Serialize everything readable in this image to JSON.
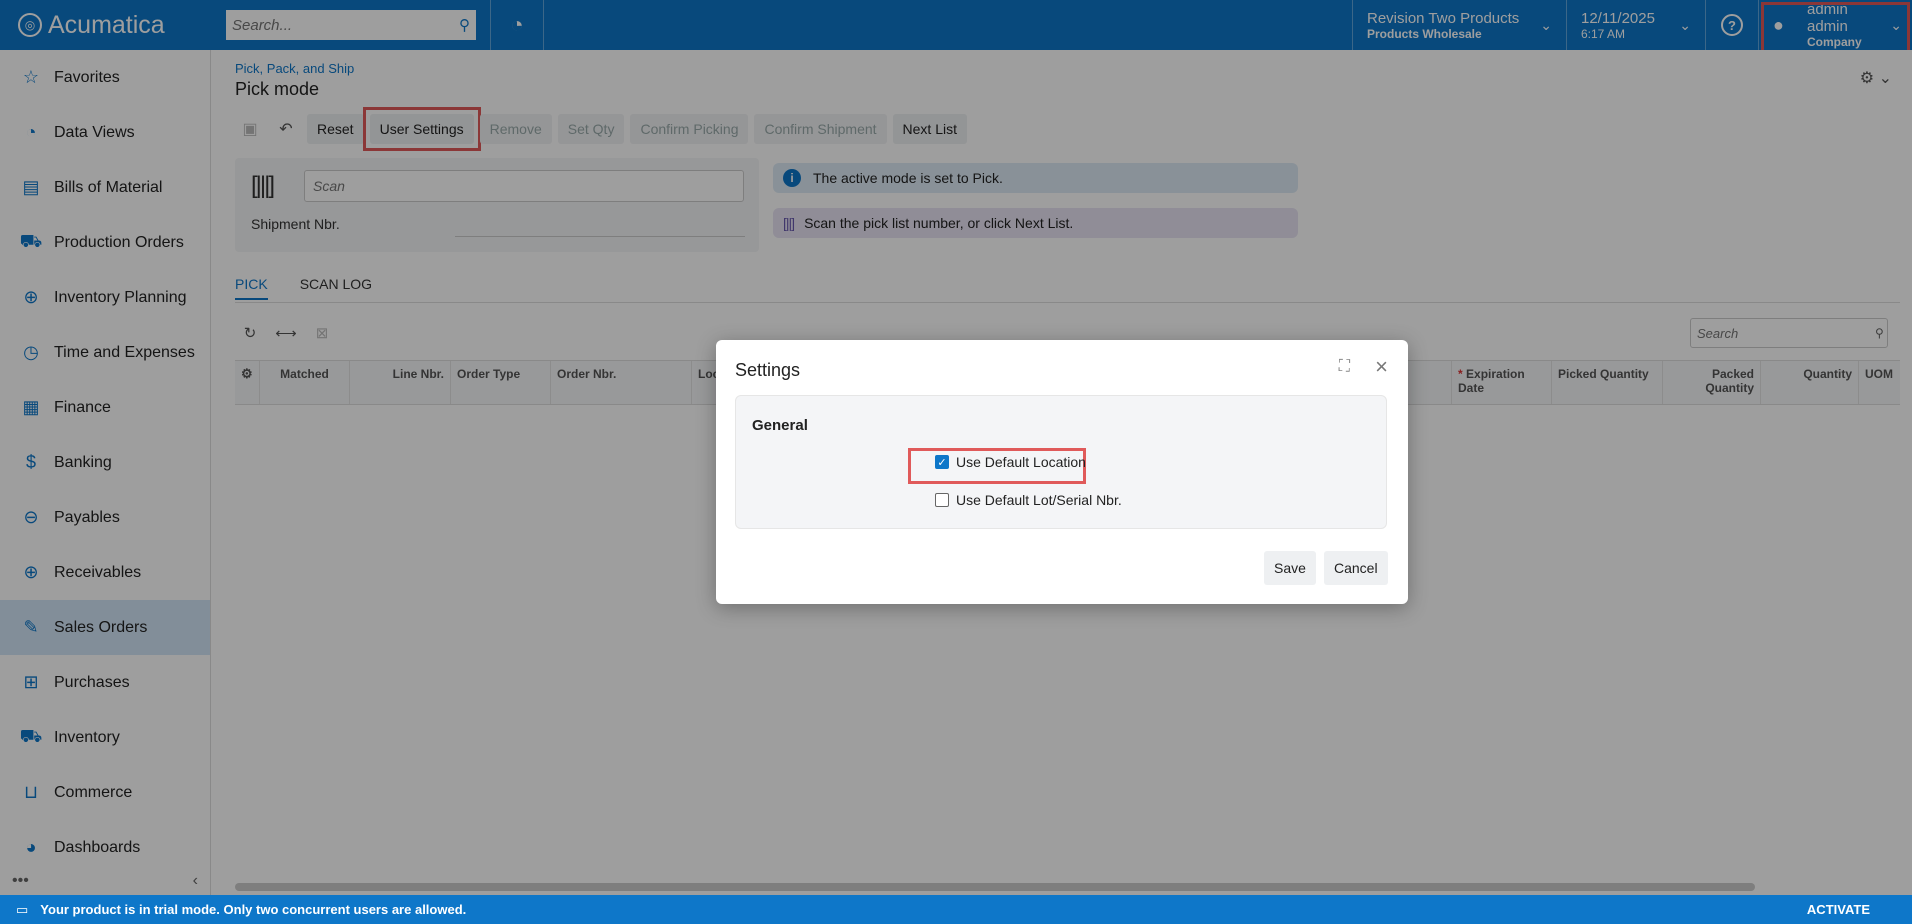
{
  "app": {
    "logo_text": "Acumatica",
    "search_placeholder": "Search..."
  },
  "header": {
    "tenant_name": "Revision Two Products",
    "tenant_branch": "Products Wholesale",
    "date": "12/11/2025",
    "time": "6:17 AM",
    "user_name": "admin admin",
    "user_company": "Company"
  },
  "sidebar": {
    "items": [
      {
        "label": "Favorites",
        "icon": "star-icon"
      },
      {
        "label": "Data Views",
        "icon": "pie-chart-icon"
      },
      {
        "label": "Bills of Material",
        "icon": "bill-icon"
      },
      {
        "label": "Production Orders",
        "icon": "truck-icon"
      },
      {
        "label": "Inventory Planning",
        "icon": "cart-plus-icon"
      },
      {
        "label": "Time and Expenses",
        "icon": "stopwatch-icon"
      },
      {
        "label": "Finance",
        "icon": "calculator-icon"
      },
      {
        "label": "Banking",
        "icon": "dollar-icon"
      },
      {
        "label": "Payables",
        "icon": "minus-circle-icon"
      },
      {
        "label": "Receivables",
        "icon": "plus-circle-icon"
      },
      {
        "label": "Sales Orders",
        "icon": "pencil-icon"
      },
      {
        "label": "Purchases",
        "icon": "cart-icon"
      },
      {
        "label": "Inventory",
        "icon": "truck-icon"
      },
      {
        "label": "Commerce",
        "icon": "basket-icon"
      },
      {
        "label": "Dashboards",
        "icon": "dashboard-icon"
      }
    ],
    "active_item": "Sales Orders"
  },
  "page": {
    "breadcrumb": "Pick, Pack, and Ship",
    "title": "Pick mode"
  },
  "toolbar": {
    "reset": "Reset",
    "user_settings": "User Settings",
    "remove": "Remove",
    "set_qty": "Set Qty",
    "confirm_picking": "Confirm Picking",
    "confirm_shipment": "Confirm Shipment",
    "next_list": "Next List"
  },
  "scan": {
    "placeholder": "Scan",
    "shipment_label": "Shipment Nbr."
  },
  "messages": {
    "info": "The active mode is set to Pick.",
    "prompt": "Scan the pick list number, or click Next List."
  },
  "tabs": [
    "PICK",
    "SCAN LOG"
  ],
  "grid": {
    "search_placeholder": "Search",
    "columns": {
      "matched": "Matched",
      "line_nbr": "Line Nbr.",
      "order_type": "Order Type",
      "order_nbr": "Order Nbr.",
      "location": "Loc",
      "expiration_date": "Expiration Date",
      "picked_qty": "Picked Quantity",
      "packed_qty": "Packed Quantity",
      "quantity": "Quantity",
      "uom": "UOM"
    }
  },
  "dialog": {
    "title": "Settings",
    "section": "General",
    "option1": "Use Default Location",
    "option1_checked": true,
    "option2": "Use Default Lot/Serial Nbr.",
    "option2_checked": false,
    "save": "Save",
    "cancel": "Cancel"
  },
  "footer": {
    "message": "Your product is in trial mode. Only two concurrent users are allowed.",
    "activate": "ACTIVATE"
  },
  "colors": {
    "brand": "#0E77C9",
    "highlight": "#E05A5A",
    "active_nav": "#D2E6F7"
  }
}
